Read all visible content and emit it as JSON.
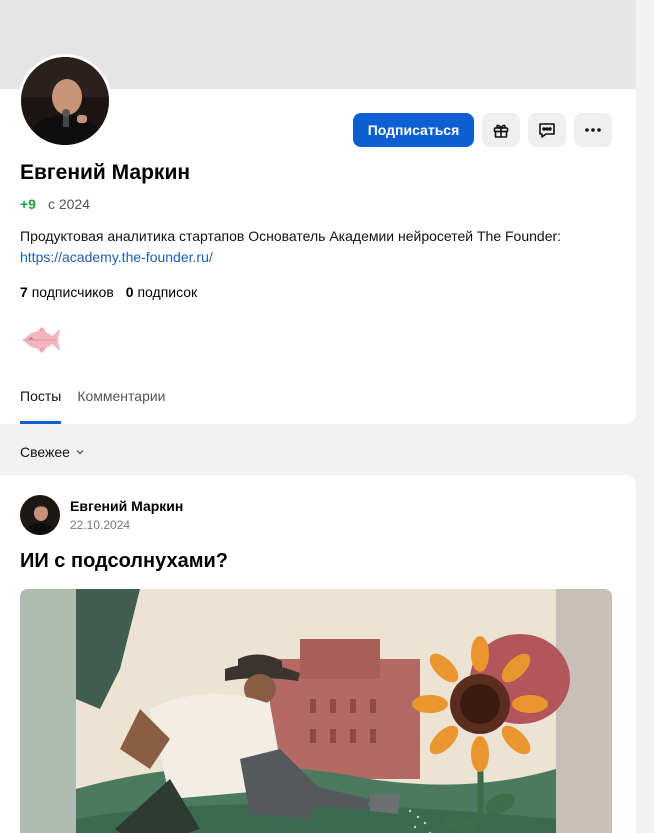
{
  "profile": {
    "name": "Евгений Маркин",
    "rating": "+9",
    "since": "с 2024",
    "bio_text": "Продуктовая аналитика стартапов Основатель Академии нейросетей The Founder:",
    "bio_link": "https://academy.the-founder.ru/",
    "followers_count": "7",
    "followers_label": "подписчиков",
    "following_count": "0",
    "following_label": "подписок",
    "badge_icon": "fish-icon"
  },
  "actions": {
    "subscribe_label": "Подписаться",
    "gift_icon": "gift-icon",
    "message_icon": "chat-icon",
    "more_icon": "more-icon"
  },
  "tabs": [
    {
      "label": "Посты",
      "active": true
    },
    {
      "label": "Комментарии",
      "active": false
    }
  ],
  "sort": {
    "label": "Свежее",
    "icon": "chevron-down-icon"
  },
  "post": {
    "author": "Евгений Маркин",
    "date": "22.10.2024",
    "title": "ИИ с подсолнухами?",
    "image_desc_icon": "illustration"
  },
  "colors": {
    "accent": "#0d5fd1",
    "rating": "#1d9f3c",
    "link": "#1a5fb4",
    "cover": "#e5e5e5",
    "background": "#f2f2f2"
  }
}
